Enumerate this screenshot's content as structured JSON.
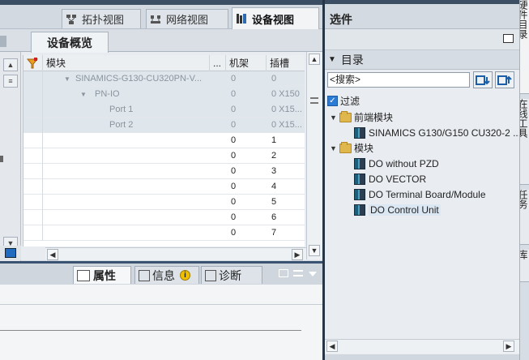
{
  "view_tabs": {
    "topology": "拓扑视图",
    "network": "网络视图",
    "device": "设备视图"
  },
  "overview": {
    "tab_label": "设备概览",
    "columns": {
      "module": "模块",
      "dots": "...",
      "rack": "机架",
      "slot": "插槽"
    },
    "rows": [
      {
        "module": "SINAMICS-G130-CU320PN-V...",
        "rack": "0",
        "slot": "0"
      },
      {
        "module": "PN-IO",
        "rack": "0",
        "slot": "0 X150"
      },
      {
        "module": "Port 1",
        "rack": "0",
        "slot": "0 X15..."
      },
      {
        "module": "Port 2",
        "rack": "0",
        "slot": "0 X15..."
      },
      {
        "module": "",
        "rack": "0",
        "slot": "1"
      },
      {
        "module": "",
        "rack": "0",
        "slot": "2"
      },
      {
        "module": "",
        "rack": "0",
        "slot": "3"
      },
      {
        "module": "",
        "rack": "0",
        "slot": "4"
      },
      {
        "module": "",
        "rack": "0",
        "slot": "5"
      },
      {
        "module": "",
        "rack": "0",
        "slot": "6"
      },
      {
        "module": "",
        "rack": "0",
        "slot": "7"
      }
    ]
  },
  "inspector": {
    "properties": "属性",
    "info": "信息",
    "diagnostics": "诊断",
    "info_badge": "i"
  },
  "right_panel": {
    "title": "选件",
    "catalog_label": "目录",
    "search_placeholder": "<搜索>",
    "filter_label": "过滤",
    "tree": {
      "front_modules": "前端模块",
      "front_device": "SINAMICS G130/G150 CU320-2 ...",
      "modules": "模块",
      "items": [
        "DO without PZD",
        "DO VECTOR",
        "DO Terminal Board/Module",
        "DO Control Unit"
      ]
    }
  },
  "side_tabs": [
    "硬件目录",
    "在线工具",
    "任务",
    "库"
  ],
  "colors": {
    "accent_dark": "#273646",
    "selection": "#dbe7f3",
    "module_row": "#dfe6ec"
  }
}
